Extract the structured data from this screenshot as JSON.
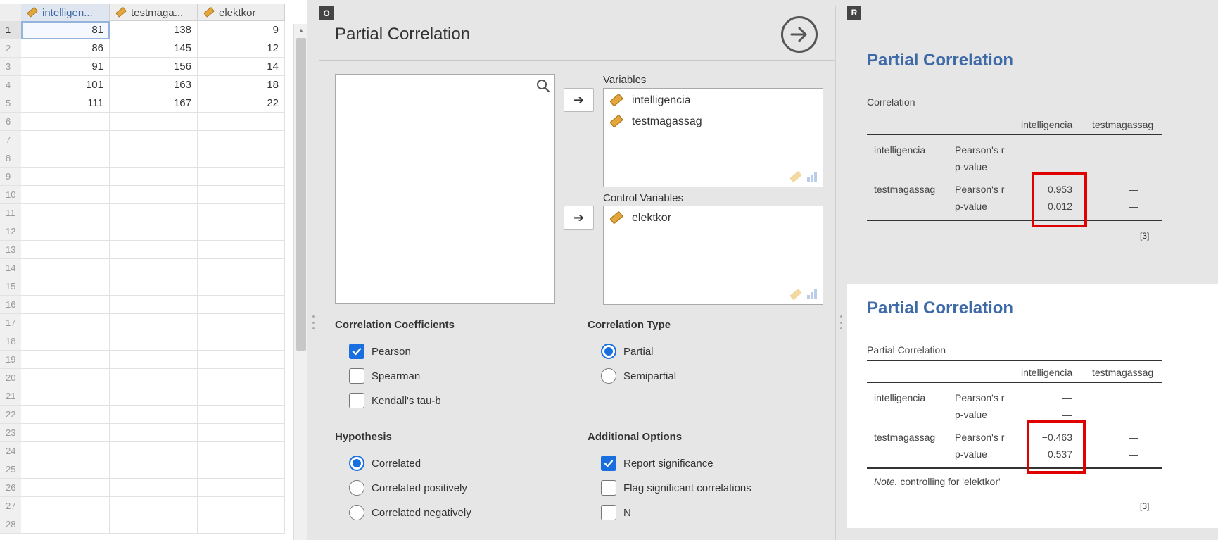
{
  "spreadsheet": {
    "columns": [
      {
        "name": "intelligen...",
        "selected": true
      },
      {
        "name": "testmaga...",
        "selected": false
      },
      {
        "name": "elektkor",
        "selected": false
      }
    ],
    "row_numbers": [
      "1",
      "2",
      "3",
      "4",
      "5",
      "6",
      "7",
      "8",
      "9",
      "10",
      "11",
      "12",
      "13",
      "14",
      "15",
      "16",
      "17",
      "18",
      "19",
      "20",
      "21",
      "22",
      "23",
      "24",
      "25",
      "26",
      "27",
      "28"
    ],
    "rows": [
      [
        "81",
        "138",
        "9"
      ],
      [
        "86",
        "145",
        "12"
      ],
      [
        "91",
        "156",
        "14"
      ],
      [
        "101",
        "163",
        "18"
      ],
      [
        "111",
        "167",
        "22"
      ]
    ]
  },
  "options": {
    "badge": "O",
    "title": "Partial Correlation",
    "variables_label": "Variables",
    "variables": [
      "intelligencia",
      "testmagassag"
    ],
    "control_label": "Control Variables",
    "control_variables": [
      "elektkor"
    ],
    "coefficients": {
      "title": "Correlation Coefficients",
      "items": [
        {
          "label": "Pearson",
          "checked": true
        },
        {
          "label": "Spearman",
          "checked": false
        },
        {
          "label": "Kendall's tau-b",
          "checked": false
        }
      ]
    },
    "type": {
      "title": "Correlation Type",
      "items": [
        {
          "label": "Partial",
          "checked": true
        },
        {
          "label": "Semipartial",
          "checked": false
        }
      ]
    },
    "hypothesis": {
      "title": "Hypothesis",
      "items": [
        {
          "label": "Correlated",
          "checked": true
        },
        {
          "label": "Correlated positively",
          "checked": false
        },
        {
          "label": "Correlated negatively",
          "checked": false
        }
      ]
    },
    "additional": {
      "title": "Additional Options",
      "items": [
        {
          "label": "Report significance",
          "checked": true
        },
        {
          "label": "Flag significant correlations",
          "checked": false
        },
        {
          "label": "N",
          "checked": false
        }
      ]
    }
  },
  "results": {
    "badge": "R",
    "first": {
      "title": "Partial Correlation",
      "caption": "Correlation",
      "col_headers": [
        "intelligencia",
        "testmagassag"
      ],
      "rows": [
        {
          "var": "intelligencia",
          "stat1": "Pearson's r",
          "stat2": "p-value",
          "c1a": "—",
          "c1b": "—",
          "c2a": "",
          "c2b": ""
        },
        {
          "var": "testmagassag",
          "stat1": "Pearson's r",
          "stat2": "p-value",
          "c1a": "0.953",
          "c1b": "0.012",
          "c2a": "—",
          "c2b": "—"
        }
      ],
      "footnote": "[3]"
    },
    "second": {
      "title": "Partial Correlation",
      "caption": "Partial Correlation",
      "col_headers": [
        "intelligencia",
        "testmagassag"
      ],
      "rows": [
        {
          "var": "intelligencia",
          "stat1": "Pearson's r",
          "stat2": "p-value",
          "c1a": "—",
          "c1b": "—",
          "c2a": "",
          "c2b": ""
        },
        {
          "var": "testmagassag",
          "stat1": "Pearson's r",
          "stat2": "p-value",
          "c1a": "−0.463",
          "c1b": "0.537",
          "c2a": "—",
          "c2b": "—"
        }
      ],
      "note_prefix": "Note.",
      "note_text": " controlling for 'elektkor'",
      "footnote": "[3]"
    },
    "highlight_color": "#e00000",
    "title_color": "#3e6aa8"
  },
  "colors": {
    "accent": "#1a6fe0",
    "ruler_icon": "#e3a63c"
  }
}
